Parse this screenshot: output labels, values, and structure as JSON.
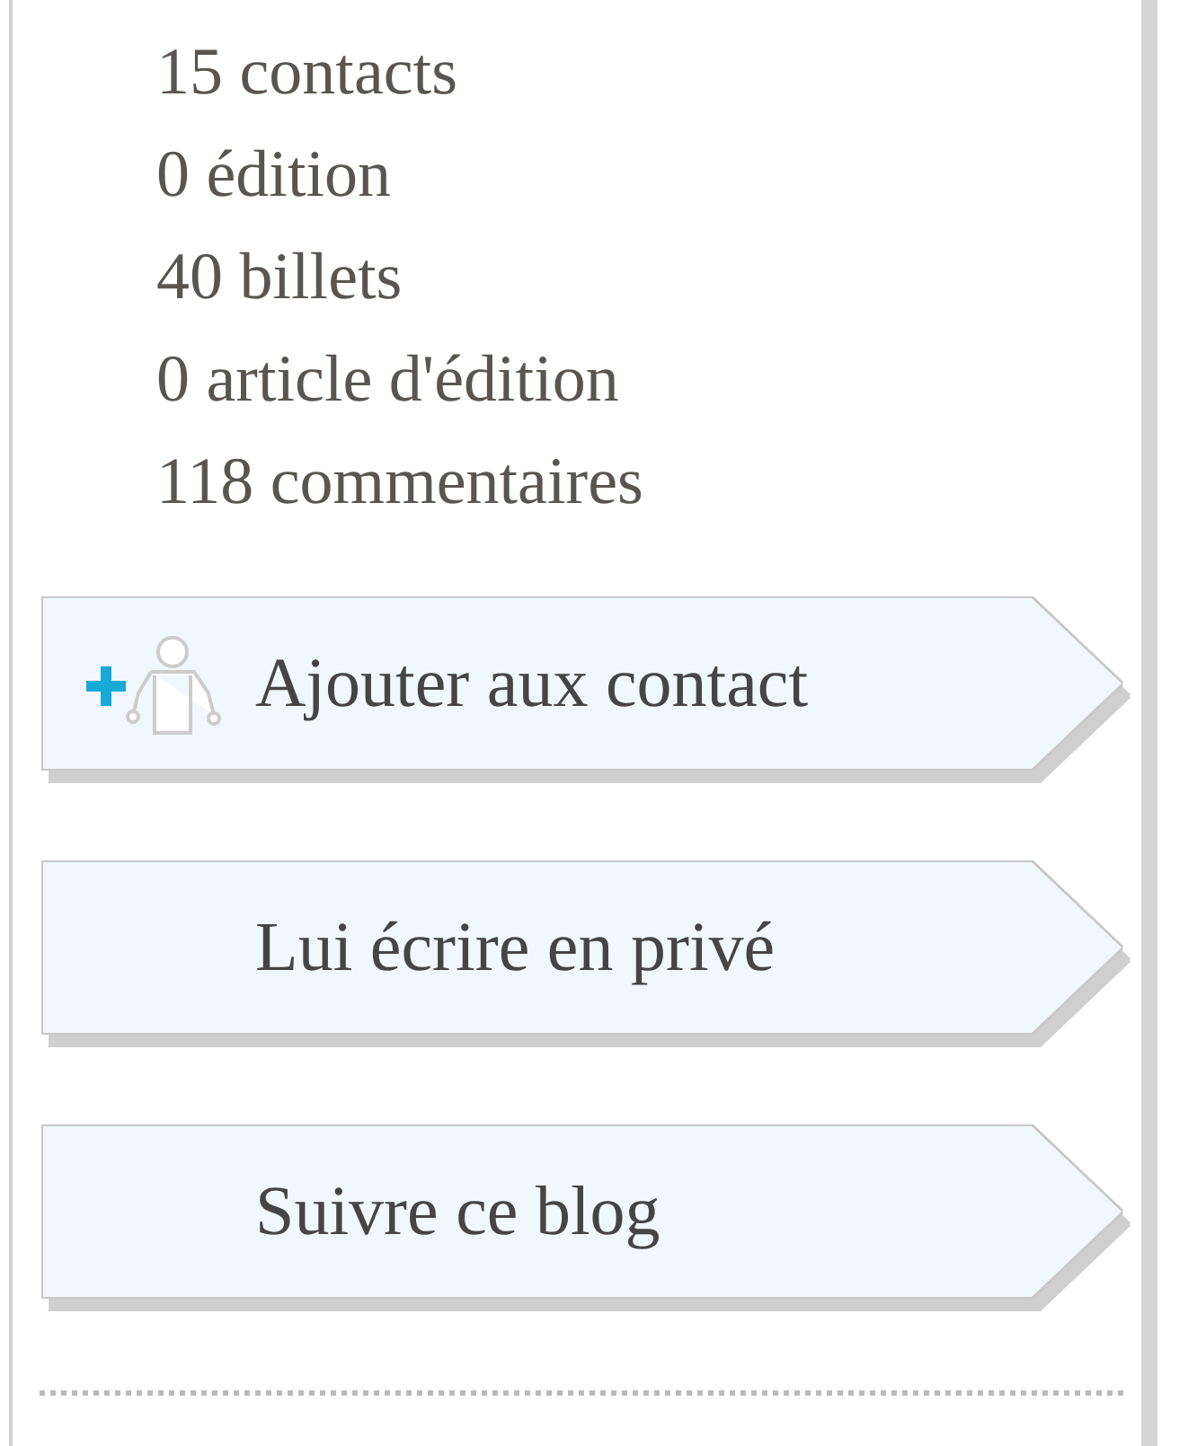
{
  "stats": [
    "15 contacts",
    "0 édition",
    "40 billets",
    "0 article d'édition",
    "118 commentaires"
  ],
  "buttons": [
    {
      "label": "Ajouter aux contact",
      "kind": "add-contact"
    },
    {
      "label": "Lui écrire en privé",
      "kind": "plain"
    },
    {
      "label": "Suivre ce blog",
      "kind": "plain"
    }
  ]
}
